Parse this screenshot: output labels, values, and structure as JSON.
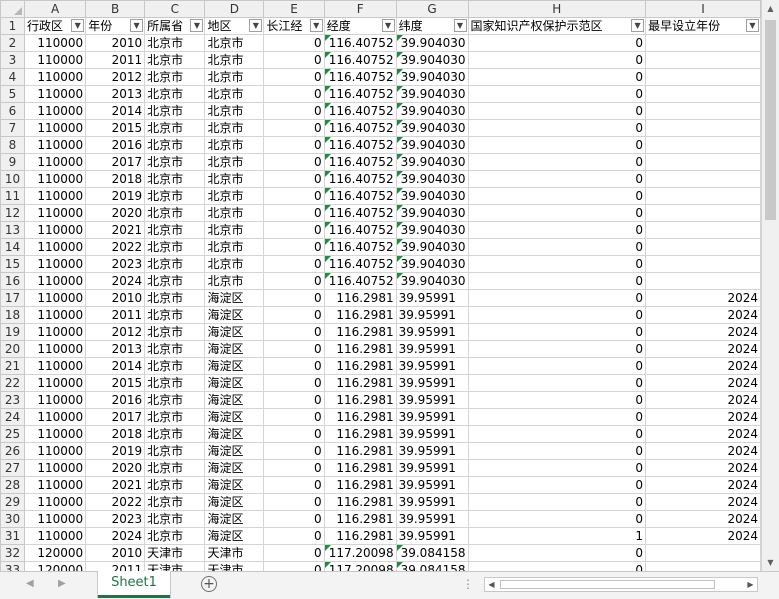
{
  "columns": [
    "A",
    "B",
    "C",
    "D",
    "E",
    "F",
    "G",
    "H",
    "I"
  ],
  "headers": [
    "行政区",
    "年份",
    "所属省",
    "地区",
    "长江经",
    "经度",
    "纬度",
    "国家知识产权保护示范区",
    "最早设立年份"
  ],
  "rows": [
    {
      "n": "2",
      "a": "110000",
      "b": "2010",
      "c": "北京市",
      "d": "北京市",
      "e": "0",
      "f": "116.40752",
      "g": "39.904030",
      "h": "0",
      "i": ""
    },
    {
      "n": "3",
      "a": "110000",
      "b": "2011",
      "c": "北京市",
      "d": "北京市",
      "e": "0",
      "f": "116.40752",
      "g": "39.904030",
      "h": "0",
      "i": ""
    },
    {
      "n": "4",
      "a": "110000",
      "b": "2012",
      "c": "北京市",
      "d": "北京市",
      "e": "0",
      "f": "116.40752",
      "g": "39.904030",
      "h": "0",
      "i": ""
    },
    {
      "n": "5",
      "a": "110000",
      "b": "2013",
      "c": "北京市",
      "d": "北京市",
      "e": "0",
      "f": "116.40752",
      "g": "39.904030",
      "h": "0",
      "i": ""
    },
    {
      "n": "6",
      "a": "110000",
      "b": "2014",
      "c": "北京市",
      "d": "北京市",
      "e": "0",
      "f": "116.40752",
      "g": "39.904030",
      "h": "0",
      "i": ""
    },
    {
      "n": "7",
      "a": "110000",
      "b": "2015",
      "c": "北京市",
      "d": "北京市",
      "e": "0",
      "f": "116.40752",
      "g": "39.904030",
      "h": "0",
      "i": ""
    },
    {
      "n": "8",
      "a": "110000",
      "b": "2016",
      "c": "北京市",
      "d": "北京市",
      "e": "0",
      "f": "116.40752",
      "g": "39.904030",
      "h": "0",
      "i": ""
    },
    {
      "n": "9",
      "a": "110000",
      "b": "2017",
      "c": "北京市",
      "d": "北京市",
      "e": "0",
      "f": "116.40752",
      "g": "39.904030",
      "h": "0",
      "i": ""
    },
    {
      "n": "10",
      "a": "110000",
      "b": "2018",
      "c": "北京市",
      "d": "北京市",
      "e": "0",
      "f": "116.40752",
      "g": "39.904030",
      "h": "0",
      "i": ""
    },
    {
      "n": "11",
      "a": "110000",
      "b": "2019",
      "c": "北京市",
      "d": "北京市",
      "e": "0",
      "f": "116.40752",
      "g": "39.904030",
      "h": "0",
      "i": ""
    },
    {
      "n": "12",
      "a": "110000",
      "b": "2020",
      "c": "北京市",
      "d": "北京市",
      "e": "0",
      "f": "116.40752",
      "g": "39.904030",
      "h": "0",
      "i": ""
    },
    {
      "n": "13",
      "a": "110000",
      "b": "2021",
      "c": "北京市",
      "d": "北京市",
      "e": "0",
      "f": "116.40752",
      "g": "39.904030",
      "h": "0",
      "i": ""
    },
    {
      "n": "14",
      "a": "110000",
      "b": "2022",
      "c": "北京市",
      "d": "北京市",
      "e": "0",
      "f": "116.40752",
      "g": "39.904030",
      "h": "0",
      "i": ""
    },
    {
      "n": "15",
      "a": "110000",
      "b": "2023",
      "c": "北京市",
      "d": "北京市",
      "e": "0",
      "f": "116.40752",
      "g": "39.904030",
      "h": "0",
      "i": ""
    },
    {
      "n": "16",
      "a": "110000",
      "b": "2024",
      "c": "北京市",
      "d": "北京市",
      "e": "0",
      "f": "116.40752",
      "g": "39.904030",
      "h": "0",
      "i": ""
    },
    {
      "n": "17",
      "a": "110000",
      "b": "2010",
      "c": "北京市",
      "d": "海淀区",
      "e": "0",
      "f": "116.2981",
      "g": "39.95991",
      "h": "0",
      "i": "2024"
    },
    {
      "n": "18",
      "a": "110000",
      "b": "2011",
      "c": "北京市",
      "d": "海淀区",
      "e": "0",
      "f": "116.2981",
      "g": "39.95991",
      "h": "0",
      "i": "2024"
    },
    {
      "n": "19",
      "a": "110000",
      "b": "2012",
      "c": "北京市",
      "d": "海淀区",
      "e": "0",
      "f": "116.2981",
      "g": "39.95991",
      "h": "0",
      "i": "2024"
    },
    {
      "n": "20",
      "a": "110000",
      "b": "2013",
      "c": "北京市",
      "d": "海淀区",
      "e": "0",
      "f": "116.2981",
      "g": "39.95991",
      "h": "0",
      "i": "2024"
    },
    {
      "n": "21",
      "a": "110000",
      "b": "2014",
      "c": "北京市",
      "d": "海淀区",
      "e": "0",
      "f": "116.2981",
      "g": "39.95991",
      "h": "0",
      "i": "2024"
    },
    {
      "n": "22",
      "a": "110000",
      "b": "2015",
      "c": "北京市",
      "d": "海淀区",
      "e": "0",
      "f": "116.2981",
      "g": "39.95991",
      "h": "0",
      "i": "2024"
    },
    {
      "n": "23",
      "a": "110000",
      "b": "2016",
      "c": "北京市",
      "d": "海淀区",
      "e": "0",
      "f": "116.2981",
      "g": "39.95991",
      "h": "0",
      "i": "2024"
    },
    {
      "n": "24",
      "a": "110000",
      "b": "2017",
      "c": "北京市",
      "d": "海淀区",
      "e": "0",
      "f": "116.2981",
      "g": "39.95991",
      "h": "0",
      "i": "2024"
    },
    {
      "n": "25",
      "a": "110000",
      "b": "2018",
      "c": "北京市",
      "d": "海淀区",
      "e": "0",
      "f": "116.2981",
      "g": "39.95991",
      "h": "0",
      "i": "2024"
    },
    {
      "n": "26",
      "a": "110000",
      "b": "2019",
      "c": "北京市",
      "d": "海淀区",
      "e": "0",
      "f": "116.2981",
      "g": "39.95991",
      "h": "0",
      "i": "2024"
    },
    {
      "n": "27",
      "a": "110000",
      "b": "2020",
      "c": "北京市",
      "d": "海淀区",
      "e": "0",
      "f": "116.2981",
      "g": "39.95991",
      "h": "0",
      "i": "2024"
    },
    {
      "n": "28",
      "a": "110000",
      "b": "2021",
      "c": "北京市",
      "d": "海淀区",
      "e": "0",
      "f": "116.2981",
      "g": "39.95991",
      "h": "0",
      "i": "2024"
    },
    {
      "n": "29",
      "a": "110000",
      "b": "2022",
      "c": "北京市",
      "d": "海淀区",
      "e": "0",
      "f": "116.2981",
      "g": "39.95991",
      "h": "0",
      "i": "2024"
    },
    {
      "n": "30",
      "a": "110000",
      "b": "2023",
      "c": "北京市",
      "d": "海淀区",
      "e": "0",
      "f": "116.2981",
      "g": "39.95991",
      "h": "0",
      "i": "2024"
    },
    {
      "n": "31",
      "a": "110000",
      "b": "2024",
      "c": "北京市",
      "d": "海淀区",
      "e": "0",
      "f": "116.2981",
      "g": "39.95991",
      "h": "1",
      "i": "2024"
    },
    {
      "n": "32",
      "a": "120000",
      "b": "2010",
      "c": "天津市",
      "d": "天津市",
      "e": "0",
      "f": "117.20098",
      "g": "39.084158",
      "h": "0",
      "i": ""
    },
    {
      "n": "33",
      "a": "120000",
      "b": "2011",
      "c": "天津市",
      "d": "天津市",
      "e": "0",
      "f": "117.20098",
      "g": "39.084158",
      "h": "0",
      "i": ""
    }
  ],
  "footer": {
    "sheet_tab": "Sheet1",
    "add_sheet": "+",
    "nav_prev": "◀",
    "nav_next": "▶",
    "more": "⋮"
  },
  "colors": {
    "accent": "#217346",
    "text_number_flag": "#1e8e3e"
  }
}
